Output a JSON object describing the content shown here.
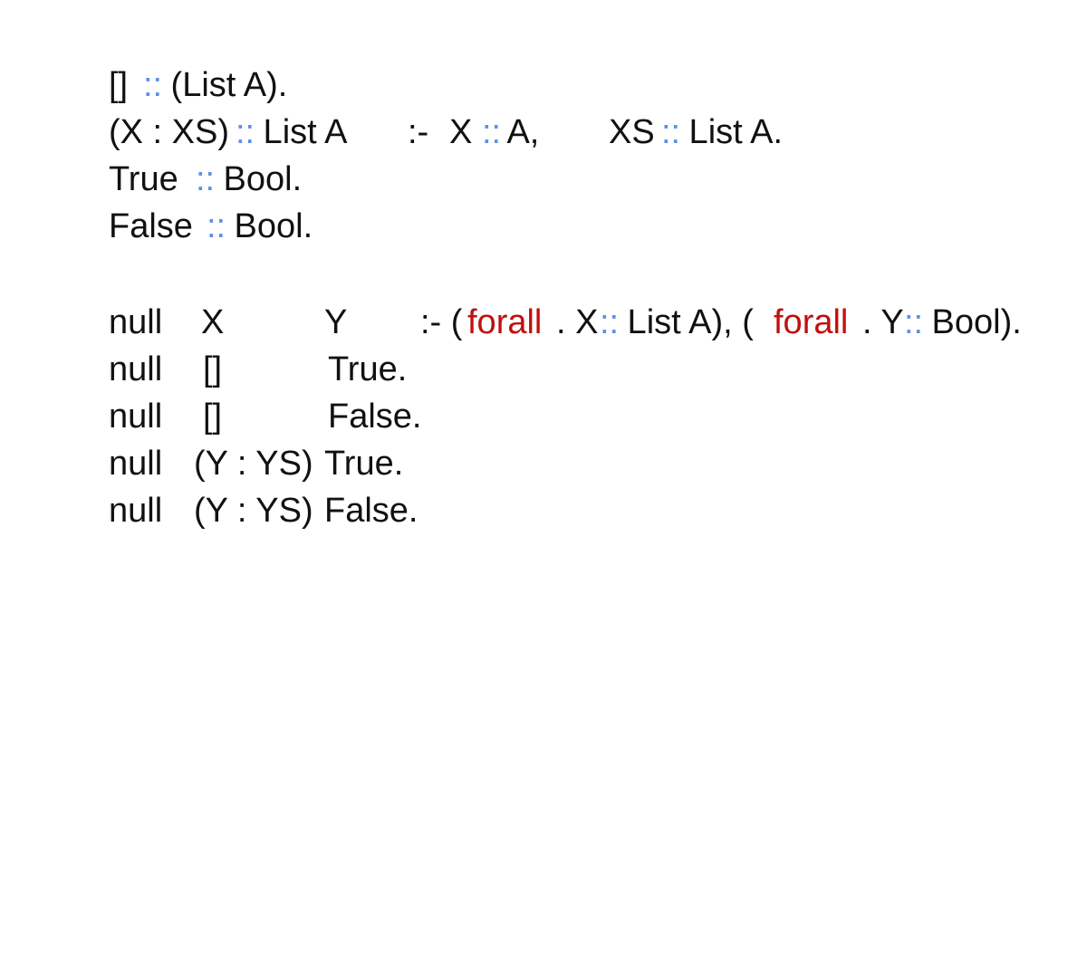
{
  "colors": {
    "text": "#111111",
    "type_operator": "#5b8fe8",
    "keyword": "#c0100e",
    "background": "#ffffff"
  },
  "type_decls": [
    {
      "parts": [
        {
          "t": "[] ",
          "s": "plain"
        },
        {
          "t": "::",
          "s": "op"
        },
        {
          "t": " (List A).",
          "s": "plain"
        }
      ]
    },
    {
      "parts": [
        {
          "t": "(X : XS) ",
          "s": "plain"
        },
        {
          "t": "::",
          "s": "op"
        },
        {
          "t": " List A",
          "s": "plain"
        }
      ],
      "rule_sep": ":-",
      "cond1": [
        {
          "t": "X ",
          "s": "plain"
        },
        {
          "t": "::",
          "s": "op"
        },
        {
          "t": " A,",
          "s": "plain"
        }
      ],
      "cond2": [
        {
          "t": "XS ",
          "s": "plain"
        },
        {
          "t": "::",
          "s": "op"
        },
        {
          "t": " List A.",
          "s": "plain"
        }
      ]
    },
    {
      "parts": [
        {
          "t": "True ",
          "s": "plain"
        },
        {
          "t": "::",
          "s": "op"
        },
        {
          "t": " Bool.",
          "s": "plain"
        }
      ]
    },
    {
      "parts": [
        {
          "t": "False ",
          "s": "plain"
        },
        {
          "t": "::",
          "s": "op"
        },
        {
          "t": " Bool.",
          "s": "plain"
        }
      ]
    }
  ],
  "null_clauses": [
    {
      "pred": "null",
      "arg1": "X",
      "arg2": "Y",
      "body": [
        {
          "t": ":- (",
          "s": "plain"
        },
        {
          "t": "forall",
          "s": "kw"
        },
        {
          "t": ". X ",
          "s": "plain"
        },
        {
          "t": "::",
          "s": "op"
        },
        {
          "t": " List A), (",
          "s": "plain"
        },
        {
          "t": "forall",
          "s": "kw"
        },
        {
          "t": ". Y ",
          "s": "plain"
        },
        {
          "t": "::",
          "s": "op"
        },
        {
          "t": " Bool).",
          "s": "plain"
        }
      ]
    },
    {
      "pred": "null",
      "arg1": "[]",
      "arg2": "True."
    },
    {
      "pred": "null",
      "arg1": "[]",
      "arg2": "False."
    },
    {
      "pred": "null",
      "arg1": "(Y : YS)",
      "arg2": "True."
    },
    {
      "pred": "null",
      "arg1": "(Y : YS)",
      "arg2": "False."
    }
  ]
}
